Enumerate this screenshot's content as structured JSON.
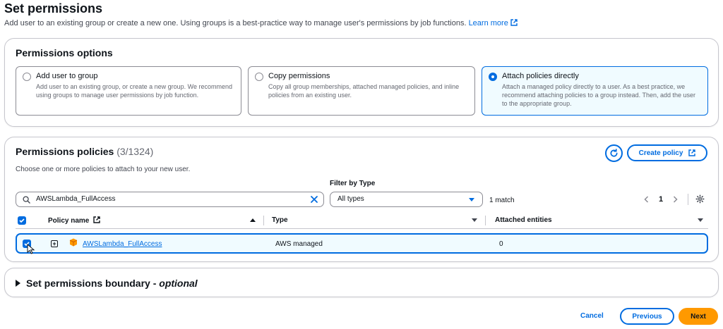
{
  "header": {
    "title": "Set permissions",
    "description": "Add user to an existing group or create a new one. Using groups is a best-practice way to manage user's permissions by job functions.",
    "learn_more": "Learn more"
  },
  "permissions_options": {
    "title": "Permissions options",
    "options": [
      {
        "label": "Add user to group",
        "description": "Add user to an existing group, or create a new group. We recommend using groups to manage user permissions by job function.",
        "selected": false
      },
      {
        "label": "Copy permissions",
        "description": "Copy all group memberships, attached managed policies, and inline policies from an existing user.",
        "selected": false
      },
      {
        "label": "Attach policies directly",
        "description": "Attach a managed policy directly to a user. As a best practice, we recommend attaching policies to a group instead. Then, add the user to the appropriate group.",
        "selected": true
      }
    ]
  },
  "permissions_policies": {
    "title": "Permissions policies",
    "count": "(3/1324)",
    "description": "Choose one or more policies to attach to your new user.",
    "create_policy_label": "Create policy",
    "search_value": "AWSLambda_FullAccess",
    "filter_label": "Filter by Type",
    "filter_value": "All types",
    "match_text": "1 match",
    "current_page": "1",
    "columns": {
      "policy_name": "Policy name",
      "type": "Type",
      "attached_entities": "Attached entities"
    },
    "rows": [
      {
        "policy_name": "AWSLambda_FullAccess",
        "type": "AWS managed",
        "attached_entities": "0",
        "checked": true
      }
    ]
  },
  "boundary": {
    "title": "Set permissions boundary - ",
    "optional": "optional"
  },
  "footer": {
    "cancel_label": "Cancel",
    "previous_label": "Previous",
    "next_label": "Next"
  },
  "colors": {
    "accent": "#006ce0",
    "primary_button": "#ff9900",
    "selected_bg": "#f0fbff",
    "aws_icon": "#ff9900"
  },
  "icons": [
    "external-link-icon",
    "radio-icon",
    "refresh-icon",
    "search-icon",
    "clear-icon",
    "chevron-left-icon",
    "chevron-right-icon",
    "gear-icon",
    "checkbox-icon",
    "expand-icon",
    "aws-policy-icon",
    "cursor-icon",
    "caret-right-icon"
  ]
}
